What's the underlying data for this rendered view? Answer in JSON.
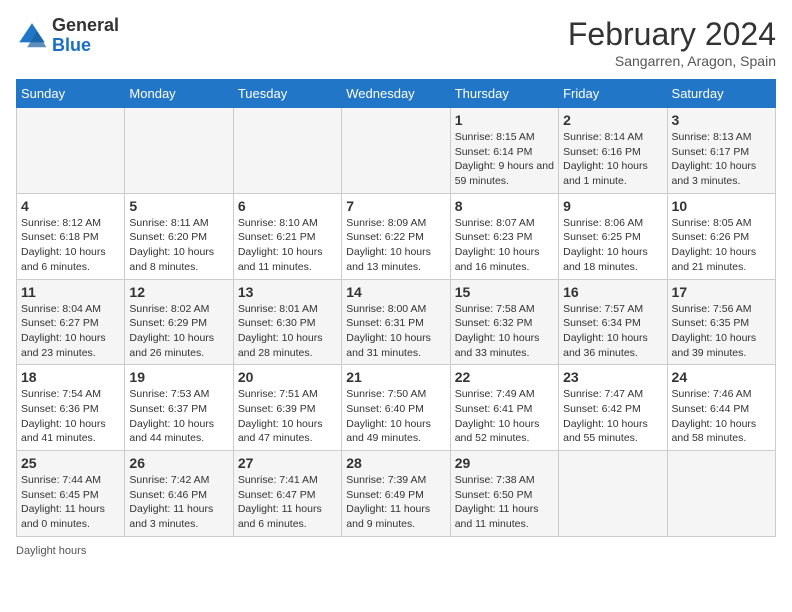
{
  "header": {
    "logo_general": "General",
    "logo_blue": "Blue",
    "month_year": "February 2024",
    "location": "Sangarren, Aragon, Spain"
  },
  "days_of_week": [
    "Sunday",
    "Monday",
    "Tuesday",
    "Wednesday",
    "Thursday",
    "Friday",
    "Saturday"
  ],
  "weeks": [
    [
      {
        "num": "",
        "info": ""
      },
      {
        "num": "",
        "info": ""
      },
      {
        "num": "",
        "info": ""
      },
      {
        "num": "",
        "info": ""
      },
      {
        "num": "1",
        "info": "Sunrise: 8:15 AM\nSunset: 6:14 PM\nDaylight: 9 hours and 59 minutes."
      },
      {
        "num": "2",
        "info": "Sunrise: 8:14 AM\nSunset: 6:16 PM\nDaylight: 10 hours and 1 minute."
      },
      {
        "num": "3",
        "info": "Sunrise: 8:13 AM\nSunset: 6:17 PM\nDaylight: 10 hours and 3 minutes."
      }
    ],
    [
      {
        "num": "4",
        "info": "Sunrise: 8:12 AM\nSunset: 6:18 PM\nDaylight: 10 hours and 6 minutes."
      },
      {
        "num": "5",
        "info": "Sunrise: 8:11 AM\nSunset: 6:20 PM\nDaylight: 10 hours and 8 minutes."
      },
      {
        "num": "6",
        "info": "Sunrise: 8:10 AM\nSunset: 6:21 PM\nDaylight: 10 hours and 11 minutes."
      },
      {
        "num": "7",
        "info": "Sunrise: 8:09 AM\nSunset: 6:22 PM\nDaylight: 10 hours and 13 minutes."
      },
      {
        "num": "8",
        "info": "Sunrise: 8:07 AM\nSunset: 6:23 PM\nDaylight: 10 hours and 16 minutes."
      },
      {
        "num": "9",
        "info": "Sunrise: 8:06 AM\nSunset: 6:25 PM\nDaylight: 10 hours and 18 minutes."
      },
      {
        "num": "10",
        "info": "Sunrise: 8:05 AM\nSunset: 6:26 PM\nDaylight: 10 hours and 21 minutes."
      }
    ],
    [
      {
        "num": "11",
        "info": "Sunrise: 8:04 AM\nSunset: 6:27 PM\nDaylight: 10 hours and 23 minutes."
      },
      {
        "num": "12",
        "info": "Sunrise: 8:02 AM\nSunset: 6:29 PM\nDaylight: 10 hours and 26 minutes."
      },
      {
        "num": "13",
        "info": "Sunrise: 8:01 AM\nSunset: 6:30 PM\nDaylight: 10 hours and 28 minutes."
      },
      {
        "num": "14",
        "info": "Sunrise: 8:00 AM\nSunset: 6:31 PM\nDaylight: 10 hours and 31 minutes."
      },
      {
        "num": "15",
        "info": "Sunrise: 7:58 AM\nSunset: 6:32 PM\nDaylight: 10 hours and 33 minutes."
      },
      {
        "num": "16",
        "info": "Sunrise: 7:57 AM\nSunset: 6:34 PM\nDaylight: 10 hours and 36 minutes."
      },
      {
        "num": "17",
        "info": "Sunrise: 7:56 AM\nSunset: 6:35 PM\nDaylight: 10 hours and 39 minutes."
      }
    ],
    [
      {
        "num": "18",
        "info": "Sunrise: 7:54 AM\nSunset: 6:36 PM\nDaylight: 10 hours and 41 minutes."
      },
      {
        "num": "19",
        "info": "Sunrise: 7:53 AM\nSunset: 6:37 PM\nDaylight: 10 hours and 44 minutes."
      },
      {
        "num": "20",
        "info": "Sunrise: 7:51 AM\nSunset: 6:39 PM\nDaylight: 10 hours and 47 minutes."
      },
      {
        "num": "21",
        "info": "Sunrise: 7:50 AM\nSunset: 6:40 PM\nDaylight: 10 hours and 49 minutes."
      },
      {
        "num": "22",
        "info": "Sunrise: 7:49 AM\nSunset: 6:41 PM\nDaylight: 10 hours and 52 minutes."
      },
      {
        "num": "23",
        "info": "Sunrise: 7:47 AM\nSunset: 6:42 PM\nDaylight: 10 hours and 55 minutes."
      },
      {
        "num": "24",
        "info": "Sunrise: 7:46 AM\nSunset: 6:44 PM\nDaylight: 10 hours and 58 minutes."
      }
    ],
    [
      {
        "num": "25",
        "info": "Sunrise: 7:44 AM\nSunset: 6:45 PM\nDaylight: 11 hours and 0 minutes."
      },
      {
        "num": "26",
        "info": "Sunrise: 7:42 AM\nSunset: 6:46 PM\nDaylight: 11 hours and 3 minutes."
      },
      {
        "num": "27",
        "info": "Sunrise: 7:41 AM\nSunset: 6:47 PM\nDaylight: 11 hours and 6 minutes."
      },
      {
        "num": "28",
        "info": "Sunrise: 7:39 AM\nSunset: 6:49 PM\nDaylight: 11 hours and 9 minutes."
      },
      {
        "num": "29",
        "info": "Sunrise: 7:38 AM\nSunset: 6:50 PM\nDaylight: 11 hours and 11 minutes."
      },
      {
        "num": "",
        "info": ""
      },
      {
        "num": "",
        "info": ""
      }
    ]
  ],
  "footer": {
    "daylight_label": "Daylight hours"
  }
}
